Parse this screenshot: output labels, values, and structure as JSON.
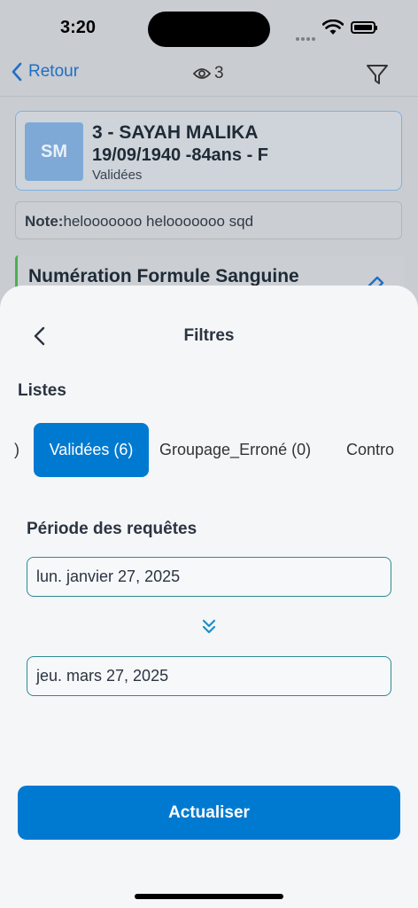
{
  "status_bar": {
    "time": "3:20"
  },
  "navbar": {
    "back_label": "Retour",
    "view_count": "3"
  },
  "patient": {
    "avatar_initials": "SM",
    "name": "3 - SAYAH MALIKA",
    "info": "19/09/1940 -84ans - F",
    "status": "Validées"
  },
  "note": {
    "label": "Note:",
    "text": "helooooooo helooooooo sqd"
  },
  "exam": {
    "title": "Numération Formule Sanguine"
  },
  "sheet": {
    "title": "Filtres",
    "lists_label": "Listes",
    "chips": {
      "partial_left": ")",
      "active": "Validées (6)",
      "groupage": "Groupage_Erroné (0)",
      "contro": "Contro"
    },
    "period_label": "Période des requêtes",
    "start_date": "lun. janvier 27, 2025",
    "end_date": "jeu. mars 27, 2025",
    "refresh_label": "Actualiser"
  },
  "colors": {
    "accent": "#007ad0",
    "link": "#1f6fc5",
    "field_border": "#2e8a92"
  },
  "icons": [
    "back-chevron-icon",
    "eye-icon",
    "filter-icon",
    "edit-icon",
    "double-chevron-down-icon",
    "wifi-icon",
    "battery-icon"
  ]
}
